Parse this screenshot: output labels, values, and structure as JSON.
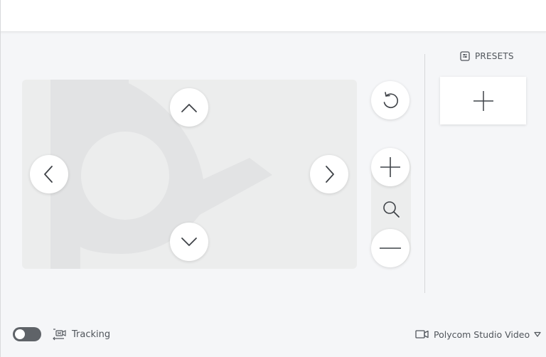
{
  "presets": {
    "label": "PRESETS"
  },
  "tracking": {
    "label": "Tracking",
    "enabled": false
  },
  "camera": {
    "selected": "Polycom Studio Video"
  },
  "icons": {
    "pan_up": "chevron-up-icon",
    "pan_down": "chevron-down-icon",
    "pan_left": "chevron-left-icon",
    "pan_right": "chevron-right-icon",
    "reset": "rotate-ccw-icon",
    "zoom_in": "plus-icon",
    "zoom": "magnifier-icon",
    "zoom_out": "minus-icon",
    "presets": "presets-icon",
    "add_preset": "plus-icon",
    "tracking": "camera-tracking-icon",
    "camera": "video-camera-icon",
    "dropdown": "caret-down-icon"
  },
  "colors": {
    "background": "#f5f6f8",
    "panel": "#eceded",
    "button": "#ffffff",
    "icon": "#4a4e54",
    "toggle_off": "#5f6368"
  }
}
